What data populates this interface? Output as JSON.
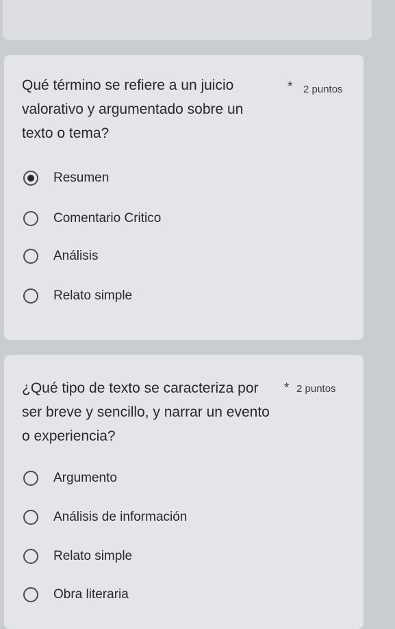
{
  "questions": [
    {
      "title": "Qué término se refiere a un juicio valorativo y argumentado sobre un texto o tema?",
      "required_mark": "*",
      "points": "2 puntos",
      "options": [
        {
          "label": "Resumen",
          "selected": true
        },
        {
          "label": "Comentario Critico",
          "selected": false
        },
        {
          "label": "Análisis",
          "selected": false
        },
        {
          "label": "Relato simple",
          "selected": false
        }
      ]
    },
    {
      "title": "¿Qué tipo de texto se caracteriza por ser breve y sencillo, y narrar un evento o experiencia?",
      "required_mark": "*",
      "points": "2 puntos",
      "options": [
        {
          "label": "Argumento",
          "selected": false
        },
        {
          "label": "Análisis de información",
          "selected": false
        },
        {
          "label": "Relato simple",
          "selected": false
        },
        {
          "label": "Obra literaria",
          "selected": false
        }
      ]
    }
  ]
}
